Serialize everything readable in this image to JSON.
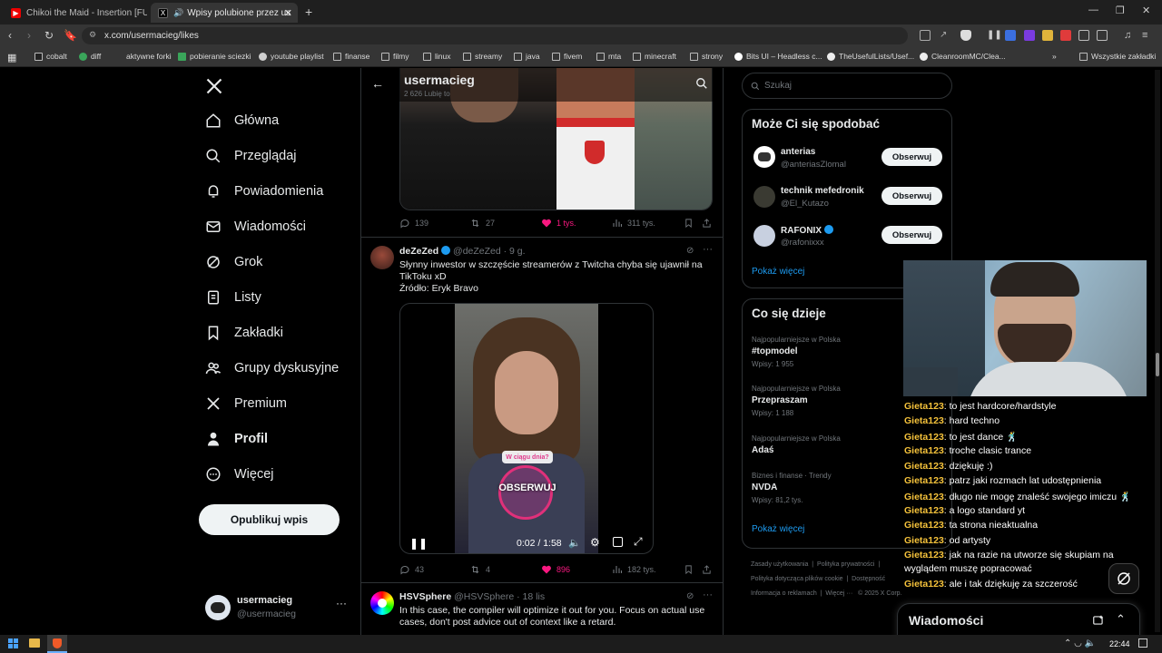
{
  "browser": {
    "tabs": [
      {
        "title": "Chikoi the Maid - Insertion [FULL",
        "active": false
      },
      {
        "title": "Wpisy polubione przez userm",
        "active": true
      }
    ],
    "url": "x.com/usermacieg/likes",
    "bookmarks": [
      "cobalt",
      "diff",
      "aktywne forki",
      "pobieranie sciezki",
      "youtube playlist",
      "finanse",
      "filmy",
      "linux",
      "streamy",
      "java",
      "fivem",
      "mta",
      "minecraft",
      "strony",
      "Bits UI – Headless c...",
      "TheUsefulLists/Usef...",
      "CleanroomMC/Clea..."
    ],
    "all_bookmarks": "Wszystkie zakładki"
  },
  "nav": {
    "items": [
      "Główna",
      "Przeglądaj",
      "Powiadomienia",
      "Wiadomości",
      "Grok",
      "Listy",
      "Zakładki",
      "Grupy dyskusyjne",
      "Premium",
      "Profil",
      "Więcej"
    ],
    "post_button": "Opublikuj wpis",
    "account_name": "usermacieg",
    "account_handle": "@usermacieg"
  },
  "header": {
    "title": "usermacieg",
    "subtitle": "2 626 Lubię to"
  },
  "tweet1": {
    "replies": "139",
    "retweets": "27",
    "likes": "1 tys.",
    "views": "311 tys."
  },
  "tweet2": {
    "name": "deZeZed",
    "handle": "@deZeZed",
    "time": "· 9 g.",
    "text1": "Słynny inwestor w szczęście streamerów z Twitcha chyba się ujawnił na",
    "text2": "TikToku xD",
    "text3": "Źródło: Eryk Bravo",
    "video_time": "0:02 / 1:58",
    "overlay_top": "W ciągu dnia?",
    "overlay_main": "OBSERWUJ",
    "replies": "43",
    "retweets": "4",
    "likes": "896",
    "views": "182 tys."
  },
  "tweet3": {
    "name": "HSVSphere",
    "handle": "@HSVSphere",
    "time": "· 18 lis",
    "text1": "In this case, the compiler will optimize it out for you. Focus on actual use",
    "text2": "cases, don't post advice out of context like a retard."
  },
  "search": {
    "placeholder": "Szukaj"
  },
  "suggest": {
    "title": "Może Ci się spodobać",
    "users": [
      {
        "name": "anterias",
        "handle": "@anteriasZlomal",
        "button": "Obserwuj"
      },
      {
        "name": "technik mefedronik",
        "handle": "@El_Kutazo",
        "button": "Obserwuj"
      },
      {
        "name": "RAFONIX",
        "handle": "@rafonixxx",
        "button": "Obserwuj"
      }
    ],
    "more": "Pokaż więcej"
  },
  "trends": {
    "title": "Co się dzieje",
    "items": [
      {
        "meta": "Najpopularniejsze w Polska",
        "name": "#topmodel",
        "count": "Wpisy: 1 955"
      },
      {
        "meta": "Najpopularniejsze w Polska",
        "name": "Przepraszam",
        "count": "Wpisy: 1 188"
      },
      {
        "meta": "Najpopularniejsze w Polska",
        "name": "Adaś",
        "count": ""
      },
      {
        "meta": "Biznes i finanse · Trendy",
        "name": "NVDA",
        "count": "Wpisy: 81,2 tys."
      }
    ],
    "more": "Pokaż więcej"
  },
  "footer": {
    "l1a": "Zasady użytkowania",
    "l1b": "Polityka prywatności",
    "l2a": "Polityka dotycząca plików cookie",
    "l2b": "Dostępność",
    "l3a": "Informacja o reklamach",
    "l3b": "Więcej ···",
    "l3c": "© 2025 X Corp."
  },
  "chat": [
    {
      "nick": "Gieta123",
      "msg": ": to jest hardcore/hardstyle"
    },
    {
      "nick": "Gieta123",
      "msg": ": hard techno"
    },
    {
      "nick": "Gieta123",
      "msg": ": to jest dance 🕺"
    },
    {
      "nick": "Gieta123",
      "msg": ": troche clasic trance"
    },
    {
      "nick": "Gieta123",
      "msg": ": dziękuję :)"
    },
    {
      "nick": "Gieta123",
      "msg": ": patrz jaki rozmach lat udostępnienia"
    },
    {
      "nick": "Gieta123",
      "msg": ": długo nie mogę znaleść swojego imiczu 🕺"
    },
    {
      "nick": "Gieta123",
      "msg": ": a logo standard yt"
    },
    {
      "nick": "Gieta123",
      "msg": ": ta strona nieaktualna"
    },
    {
      "nick": "Gieta123",
      "msg": ": od artysty"
    },
    {
      "nick": "Gieta123",
      "msg": ": jak na razie na utworze się skupiam na"
    },
    {
      "nick": "",
      "msg": "wyglądem muszę popracować"
    },
    {
      "nick": "Gieta123",
      "msg": ": ale i tak dziękuję za szczerość"
    }
  ],
  "messages_bar": {
    "title": "Wiadomości"
  },
  "taskbar": {
    "time": "22:44"
  },
  "colors": {
    "accent": "#1d9bf0",
    "like": "#f91880",
    "chat_nick": "#f5c23b"
  }
}
